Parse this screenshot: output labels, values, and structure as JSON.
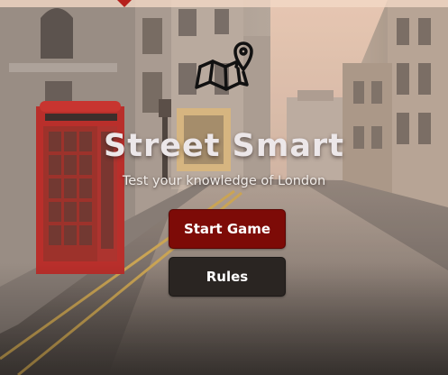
{
  "app": {
    "title": "Street Smart",
    "subtitle": "Test your knowledge of London",
    "icon": "folded-map-location-pin-icon"
  },
  "buttons": {
    "start_label": "Start Game",
    "rules_label": "Rules"
  },
  "colors": {
    "start_button": "#7d0b07",
    "rules_button": "#2a2522",
    "title_text": "#ece7e9"
  },
  "background": {
    "scene": "rainy-london-street-red-phone-box"
  }
}
